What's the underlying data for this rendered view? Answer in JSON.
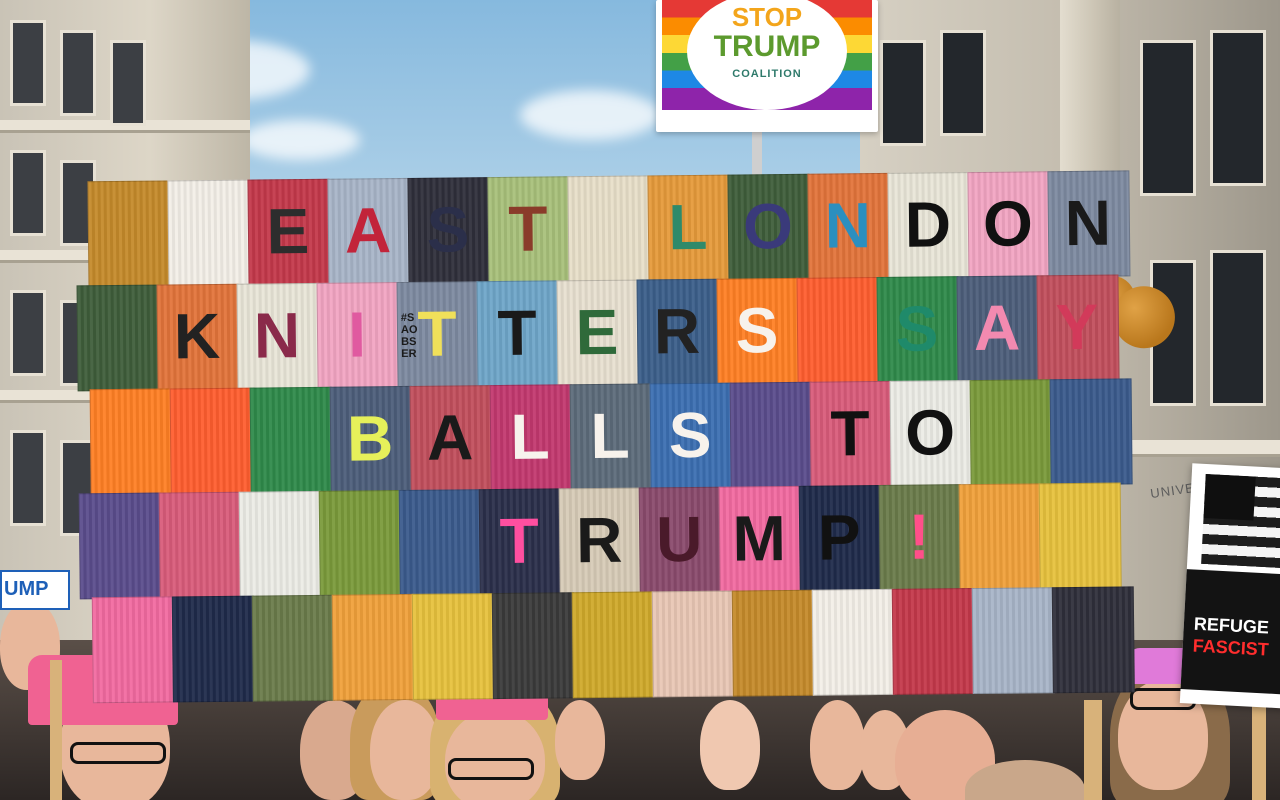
{
  "colors": {
    "sky": "#9cc6e4",
    "blanket_border": "#7b3b52"
  },
  "top_sign": {
    "line1": "STOP",
    "line2": "TRUMP",
    "line3": "COALITION"
  },
  "blanket": {
    "letters": [
      "E",
      "A",
      "S",
      "T",
      "L",
      "O",
      "N",
      "D",
      "O",
      "N",
      "K",
      "N",
      "I",
      "T",
      "T",
      "E",
      "R",
      "S",
      "S",
      "A",
      "Y",
      "B",
      "A",
      "L",
      "L",
      "S",
      "T",
      "O",
      "T",
      "R",
      "U",
      "M",
      "P",
      "!"
    ],
    "side_tag": "#SAO BSER"
  },
  "placard_right": {
    "line1": "REFUGE",
    "line2": "FASCIST"
  },
  "building_sign": "UNIVERSITY",
  "left_sign": "UMP"
}
